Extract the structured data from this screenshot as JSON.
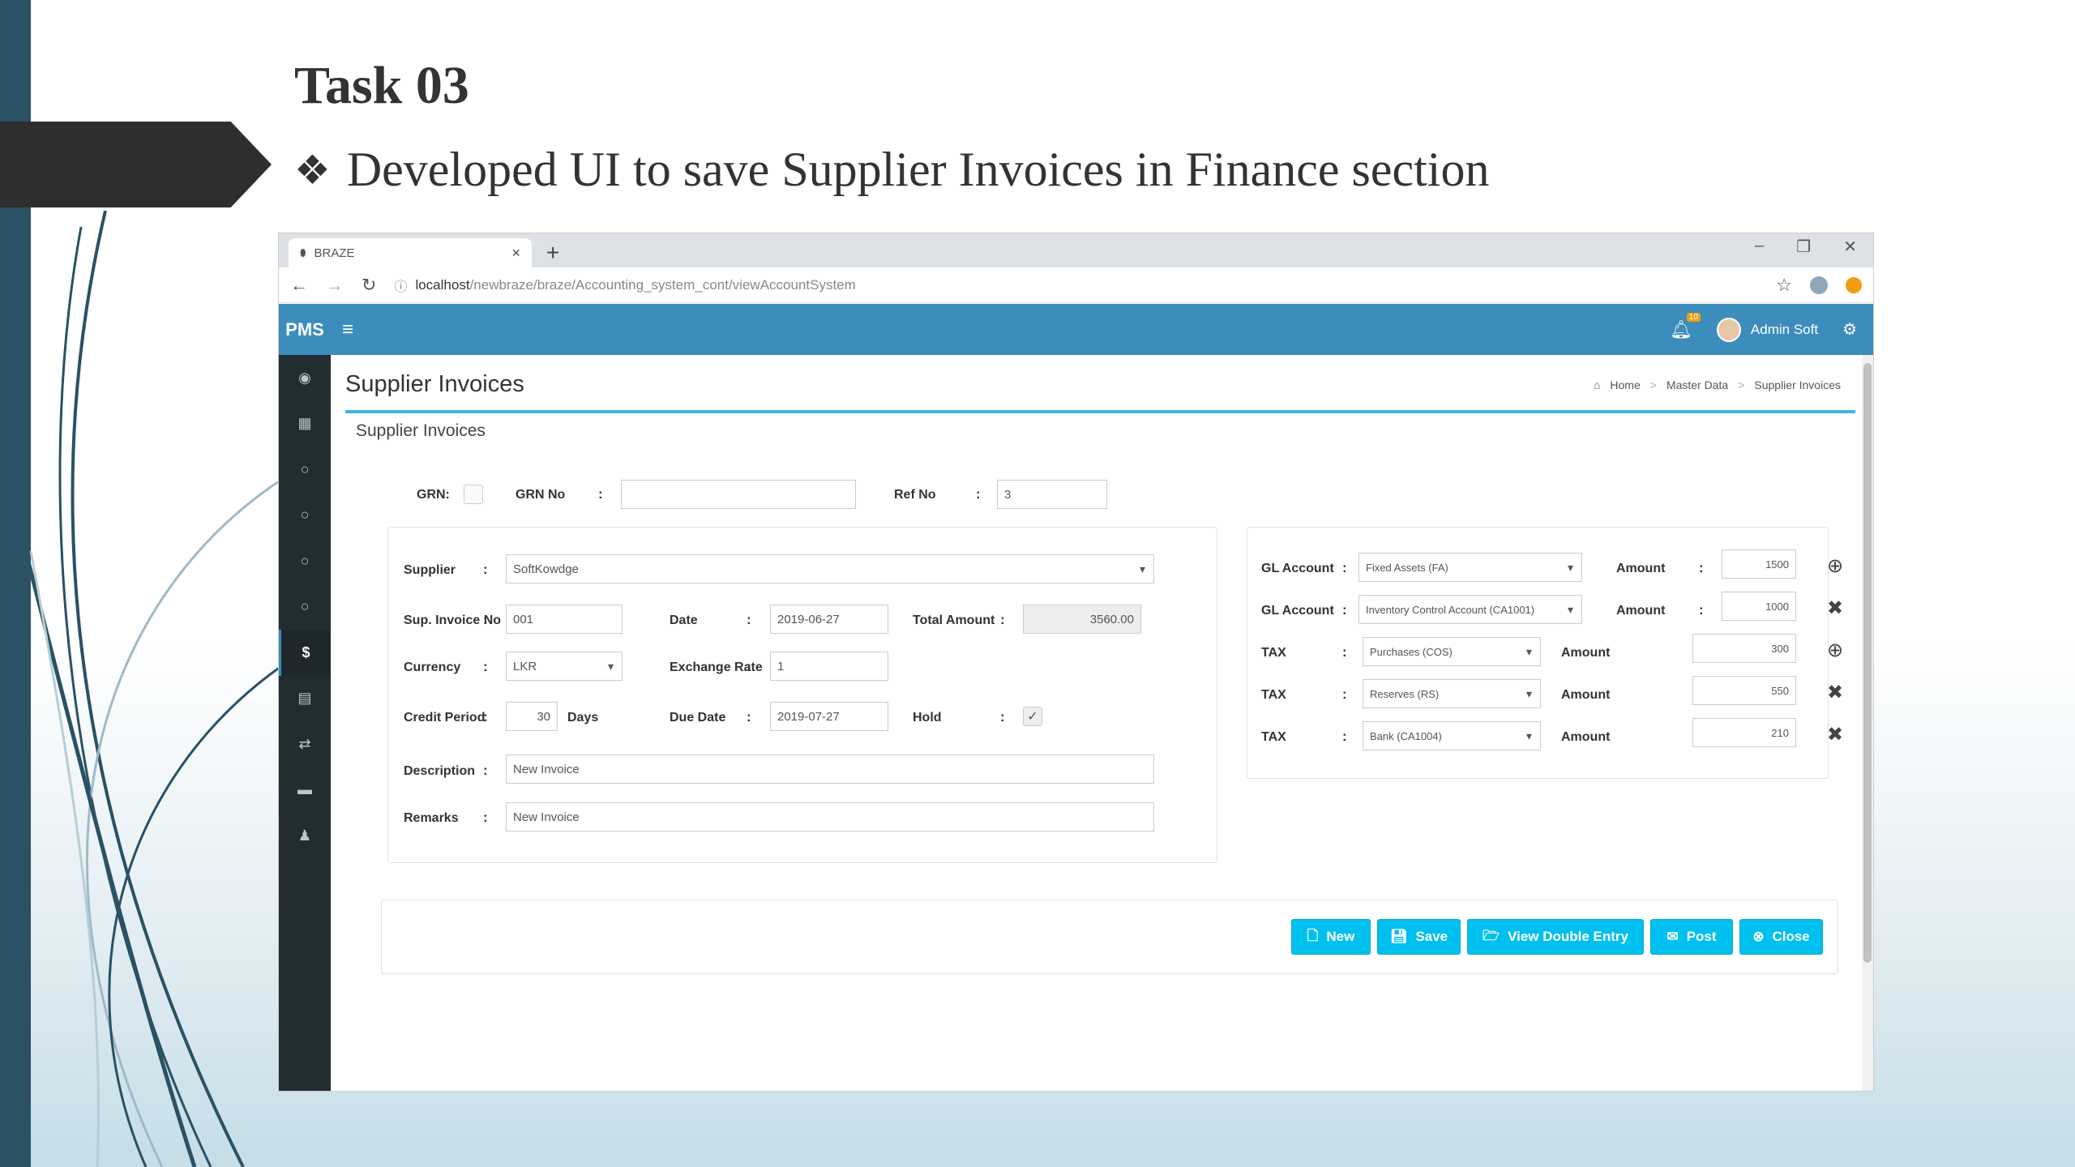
{
  "slide": {
    "title": "Task 03",
    "bullet_glyph": "❖",
    "bullet_text": "Developed UI to save Supplier Invoices in Finance section"
  },
  "browser": {
    "tab_title": "BRAZE",
    "url_host": "localhost",
    "url_path": "/newbraze/braze/Accounting_system_cont/viewAccountSystem"
  },
  "app": {
    "logo": "PMS",
    "notification_count": "10",
    "user_name": "Admin Soft",
    "accent_color": "#3c8dbc",
    "sidebar_icons": [
      "dashboard-icon",
      "grid-icon",
      "circle-icon",
      "circle-icon",
      "circle-icon",
      "circle-icon",
      "dollar-icon",
      "document-icon",
      "retweet-icon",
      "folder-icon",
      "user-icon"
    ],
    "sidebar_glyphs": [
      "◉",
      "▦",
      "○",
      "○",
      "○",
      "○",
      "$",
      "▤",
      "⇄",
      "▬",
      "♟"
    ]
  },
  "page": {
    "title": "Supplier Invoices",
    "breadcrumb": [
      "Home",
      "Master Data",
      "Supplier Invoices"
    ],
    "box_title": "Supplier Invoices"
  },
  "form": {
    "grn_label": "GRN:",
    "grn_no_label": "GRN No",
    "grn_no_value": "",
    "ref_no_label": "Ref No",
    "ref_no_value": "3",
    "supplier_label": "Supplier",
    "supplier_value": "SoftKowdge",
    "sup_invoice_no_label": "Sup. Invoice No",
    "sup_invoice_no_value": "001",
    "date_label": "Date",
    "date_value": "2019-06-27",
    "total_amount_label": "Total Amount",
    "total_amount_value": "3560.00",
    "currency_label": "Currency",
    "currency_value": "LKR",
    "exchange_rate_label": "Exchange Rate",
    "exchange_rate_value": "1",
    "credit_period_label": "Credit Period",
    "credit_period_value": "30",
    "days_label": "Days",
    "due_date_label": "Due Date",
    "due_date_value": "2019-07-27",
    "hold_label": "Hold",
    "hold_checked": true,
    "description_label": "Description",
    "description_value": "New Invoice",
    "remarks_label": "Remarks",
    "remarks_value": "New Invoice"
  },
  "accounts": [
    {
      "label": "GL Account",
      "account": "Fixed Assets (FA)",
      "amount_label": "Amount",
      "amount": "1500",
      "action": "add"
    },
    {
      "label": "GL Account",
      "account": "Inventory Control Account (CA1001)",
      "amount_label": "Amount",
      "amount": "1000",
      "action": "remove"
    },
    {
      "label": "TAX",
      "account": "Purchases (COS)",
      "amount_label": "Amount",
      "amount": "300",
      "action": "add"
    },
    {
      "label": "TAX",
      "account": "Reserves (RS)",
      "amount_label": "Amount",
      "amount": "550",
      "action": "remove"
    },
    {
      "label": "TAX",
      "account": "Bank (CA1004)",
      "amount_label": "Amount",
      "amount": "210",
      "action": "remove"
    }
  ],
  "buttons": {
    "new": "New",
    "save": "Save",
    "view_double_entry": "View Double Entry",
    "post": "Post",
    "close": "Close",
    "color": "#00c0ef"
  }
}
